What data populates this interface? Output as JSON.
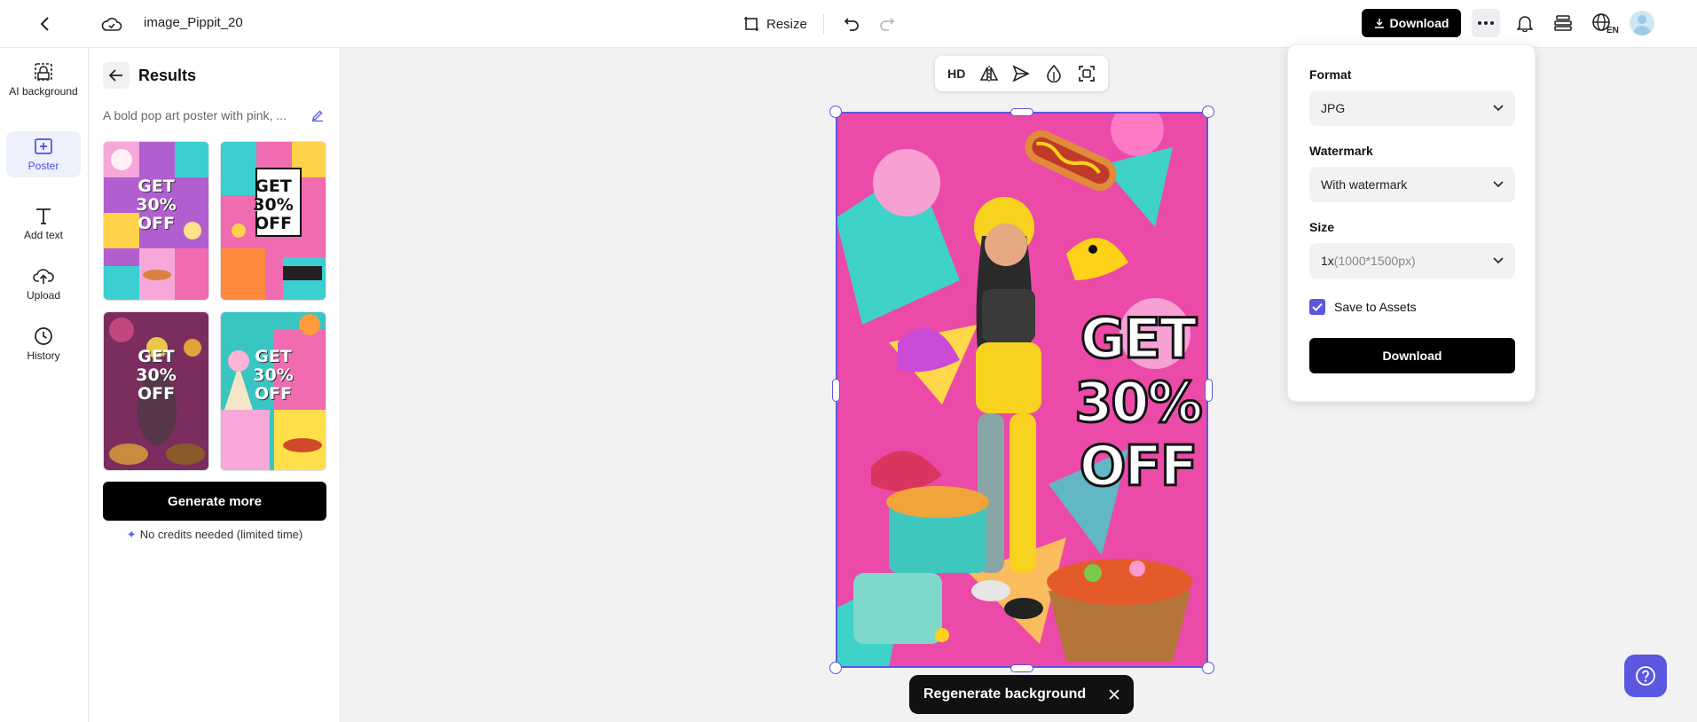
{
  "topbar": {
    "file_name": "image_Pippit_20",
    "resize_label": "Resize",
    "download_label": "Download",
    "lang_icon": "globe-en-icon"
  },
  "rail": {
    "items": [
      {
        "label": "AI background",
        "icon": "ai-background-icon"
      },
      {
        "label": "Poster",
        "icon": "poster-icon",
        "active": true
      },
      {
        "label": "Add text",
        "icon": "text-icon"
      },
      {
        "label": "Upload",
        "icon": "upload-cloud-icon"
      },
      {
        "label": "History",
        "icon": "clock-icon"
      }
    ]
  },
  "results": {
    "title": "Results",
    "prompt": "A bold pop art poster with pink, ...",
    "thumbnails": [
      {
        "text": "GET\n30%\nOFF",
        "bg": "#b15fd0"
      },
      {
        "text": "GET\n30%\nOFF",
        "bg": "#f06bb0"
      },
      {
        "text": "GET\n30%\nOFF",
        "bg": "#7a2d5e"
      },
      {
        "text": "GET\n30%\nOFF",
        "bg": "#39c6c2"
      }
    ],
    "generate_label": "Generate more",
    "credits_note": "No credits needed (limited time)"
  },
  "canvas": {
    "toolbar": {
      "hd_label": "HD"
    },
    "poster_text": "GET\n30%\nOFF",
    "regen_label": "Regenerate background"
  },
  "download_panel": {
    "format_label": "Format",
    "format_value": "JPG",
    "watermark_label": "Watermark",
    "watermark_value": "With watermark",
    "size_label": "Size",
    "size_scale": "1x",
    "size_px": "(1000*1500px)",
    "save_label": "Save to Assets",
    "save_checked": true,
    "button_label": "Download"
  },
  "colors": {
    "accent": "#5b57e0",
    "primary_button": "#000000",
    "canvas_bg": "#f2f2f2"
  }
}
